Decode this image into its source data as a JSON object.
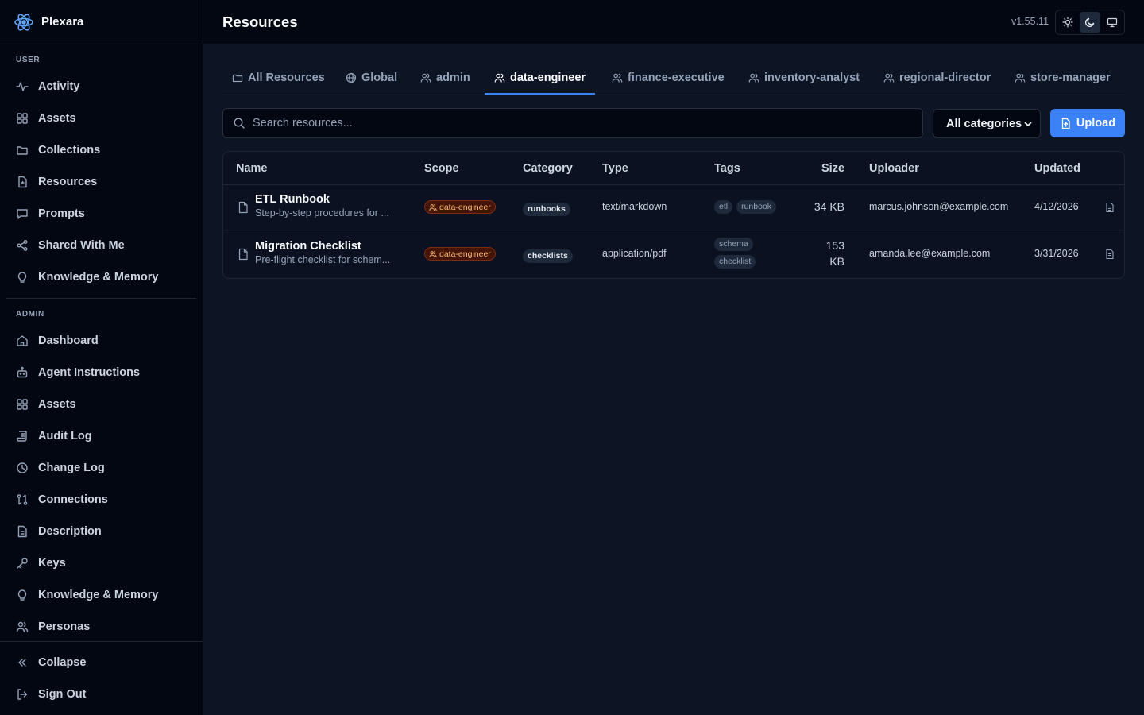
{
  "app": {
    "name": "Plexara",
    "version": "v1.55.11"
  },
  "header": {
    "title": "Resources"
  },
  "sidebar": {
    "user_label": "USER",
    "user_items": [
      {
        "label": "Activity",
        "icon": "activity-icon"
      },
      {
        "label": "Assets",
        "icon": "grid-icon"
      },
      {
        "label": "Collections",
        "icon": "folder-icon"
      },
      {
        "label": "Resources",
        "icon": "file-icon"
      },
      {
        "label": "Prompts",
        "icon": "message-icon"
      },
      {
        "label": "Shared With Me",
        "icon": "share-icon"
      },
      {
        "label": "Knowledge & Memory",
        "icon": "lightbulb-icon"
      }
    ],
    "admin_label": "ADMIN",
    "admin_items": [
      {
        "label": "Dashboard",
        "icon": "home-icon"
      },
      {
        "label": "Agent Instructions",
        "icon": "bot-icon"
      },
      {
        "label": "Assets",
        "icon": "grid-icon"
      },
      {
        "label": "Audit Log",
        "icon": "scroll-icon"
      },
      {
        "label": "Change Log",
        "icon": "clock-icon"
      },
      {
        "label": "Connections",
        "icon": "connections-icon"
      },
      {
        "label": "Description",
        "icon": "file-text-icon"
      },
      {
        "label": "Keys",
        "icon": "key-icon"
      },
      {
        "label": "Knowledge & Memory",
        "icon": "lightbulb-icon"
      },
      {
        "label": "Personas",
        "icon": "users-icon"
      }
    ],
    "collapse_label": "Collapse",
    "signout_label": "Sign Out"
  },
  "tabs": [
    {
      "label": "All Resources",
      "icon": "folder-icon",
      "active": false
    },
    {
      "label": "Global",
      "icon": "globe-icon",
      "active": false
    },
    {
      "label": "admin",
      "icon": "users-icon",
      "active": false
    },
    {
      "label": "data-engineer",
      "icon": "users-icon",
      "active": true
    },
    {
      "label": "finance-executive",
      "icon": "users-icon",
      "active": false
    },
    {
      "label": "inventory-analyst",
      "icon": "users-icon",
      "active": false
    },
    {
      "label": "regional-director",
      "icon": "users-icon",
      "active": false
    },
    {
      "label": "store-manager",
      "icon": "users-icon",
      "active": false
    }
  ],
  "toolbar": {
    "search_placeholder": "Search resources...",
    "category_selected": "All categories",
    "upload_label": "Upload"
  },
  "table": {
    "columns": [
      "Name",
      "Scope",
      "Category",
      "Type",
      "Tags",
      "Size",
      "Uploader",
      "Updated"
    ],
    "rows": [
      {
        "name": "ETL Runbook",
        "description": "Step-by-step procedures for ...",
        "scope": "data-engineer",
        "category": "runbooks",
        "type": "text/markdown",
        "tags": [
          "etl",
          "runbook"
        ],
        "size": "34 KB",
        "uploader": "marcus.johnson@example.com",
        "updated": "4/12/2026"
      },
      {
        "name": "Migration Checklist",
        "description": "Pre-flight checklist for schem...",
        "scope": "data-engineer",
        "category": "checklists",
        "type": "application/pdf",
        "tags": [
          "schema",
          "checklist"
        ],
        "size_line1": "153",
        "size_line2": "KB",
        "uploader": "amanda.lee@example.com",
        "updated": "3/31/2026"
      }
    ]
  },
  "colors": {
    "accent": "#3b82f6",
    "scope_badge": "#fdba74",
    "background": "#0d1424",
    "sidebar": "#030712"
  }
}
